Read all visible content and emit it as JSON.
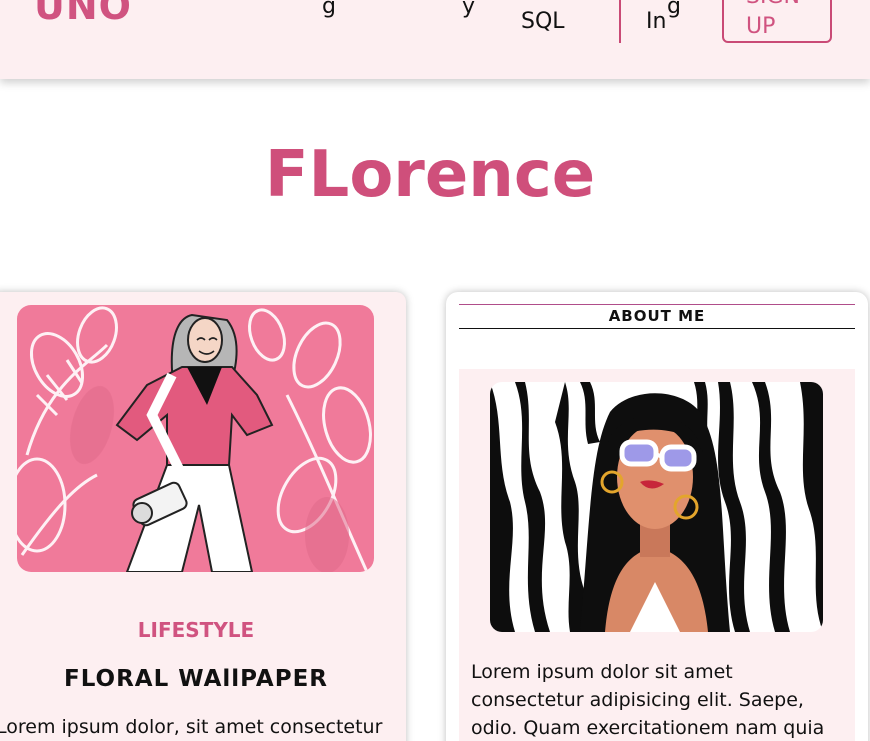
{
  "header": {
    "logo": "UNO",
    "nav_sql": "SQL",
    "login": "In",
    "signup_line1": "SIGN",
    "signup_line2": "UP"
  },
  "page_title": "FLorence",
  "post": {
    "category": "LIFESTYLE",
    "title": "FLORAL WAllPAPER",
    "excerpt": "Lorem ipsum dolor, sit amet consectetur"
  },
  "about": {
    "heading": "ABOUT ME",
    "text": "Lorem ipsum dolor sit amet consectetur adipisicing elit. Saepe, odio. Quam exercitationem nam quia delectus"
  },
  "colors": {
    "accent": "#d05380",
    "header_bg": "#fdeff1",
    "card_bg": "#fdeff1"
  }
}
